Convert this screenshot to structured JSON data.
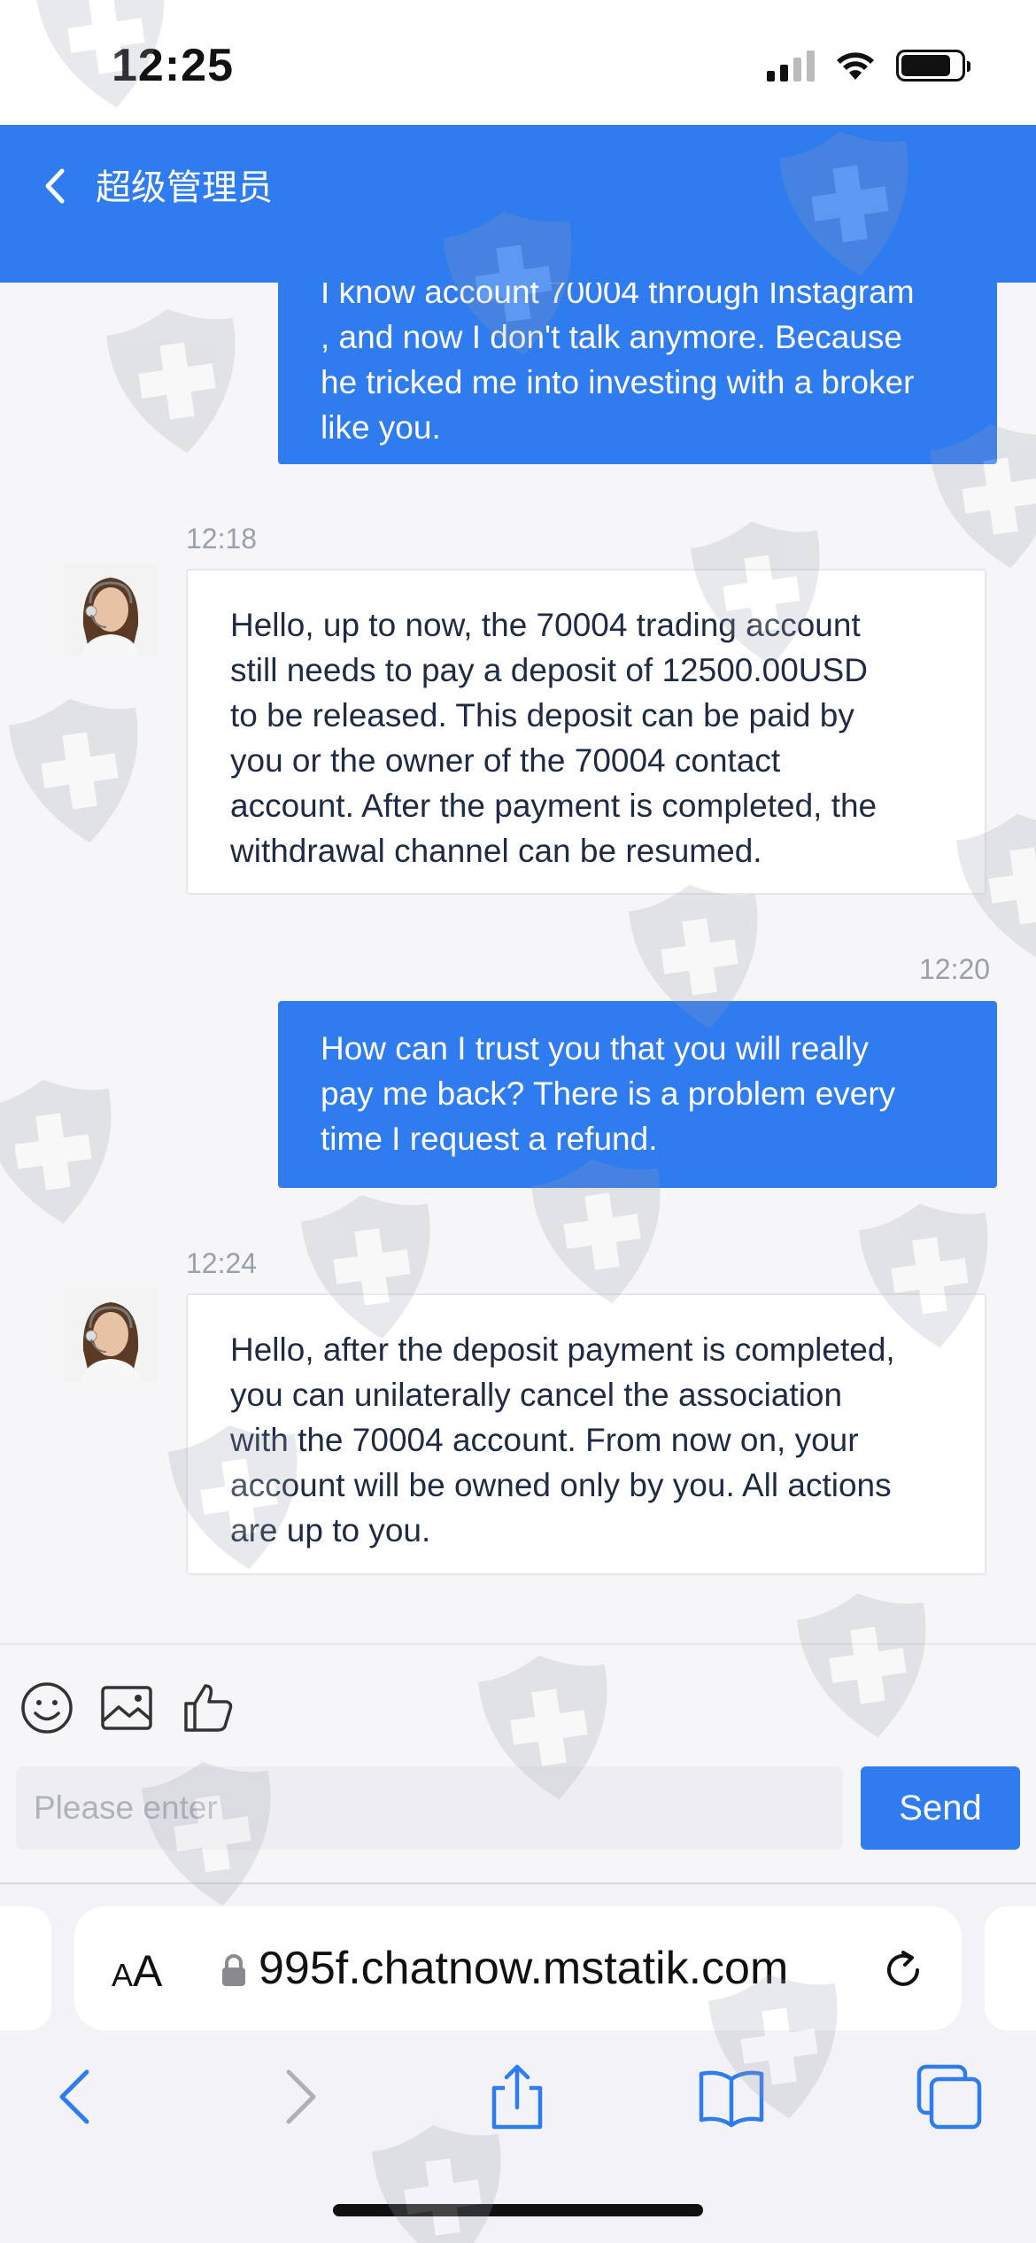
{
  "status_bar": {
    "time": "12:25"
  },
  "header": {
    "title": "超级管理员"
  },
  "messages": [
    {
      "direction": "outgoing",
      "time": "",
      "lines": [
        "I know account 70004 through Instagram",
        ", and now I don't talk anymore. Because",
        "he tricked me into investing with a broker",
        "like you."
      ]
    },
    {
      "direction": "incoming",
      "time": "12:18",
      "lines": [
        "Hello, up to now, the 70004 trading account",
        "still needs to pay a deposit of 12500.00USD",
        "to be released. This deposit can be paid by",
        "you or the owner of the 70004 contact",
        "account. After the payment is completed, the",
        "withdrawal channel can be resumed."
      ]
    },
    {
      "direction": "outgoing",
      "time": "12:20",
      "lines": [
        "How can I trust you that you will really",
        "pay me back? There is a problem every",
        "time I request a refund."
      ]
    },
    {
      "direction": "incoming",
      "time": "12:24",
      "lines": [
        "Hello, after the deposit payment is completed,",
        "you can unilaterally cancel the association",
        "with the 70004 account. From now on, your",
        "account will be owned only by you. All actions",
        "are up to you."
      ]
    }
  ],
  "composer": {
    "tools": [
      "emoji-icon",
      "image-icon",
      "thumbs-up-icon"
    ],
    "placeholder": "Please enter",
    "send_label": "Send"
  },
  "browser": {
    "aa_small": "A",
    "aa_large": "A",
    "url": "995f.chatnow.mstatik.com",
    "nav_icons": [
      "back-icon",
      "forward-icon",
      "share-icon",
      "bookmarks-icon",
      "tabs-icon"
    ]
  },
  "colors": {
    "accent": "#2f7bf0",
    "background": "#f6f6f8",
    "watermark": "#9aa0aa"
  }
}
